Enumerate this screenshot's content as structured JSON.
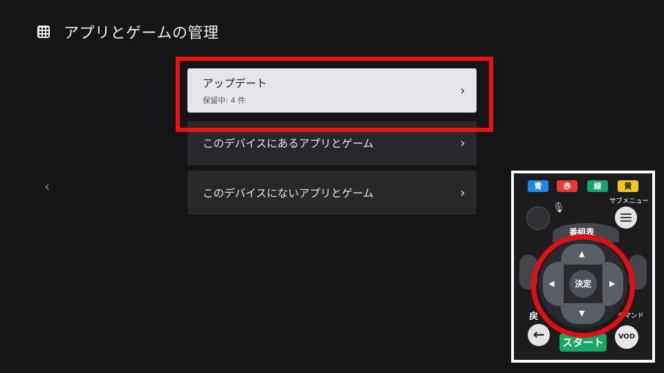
{
  "header": {
    "title": "アプリとゲームの管理",
    "icon": "apps-grid-icon"
  },
  "nav": {
    "back_icon": "chevron-left-icon"
  },
  "menu": {
    "items": [
      {
        "label": "アップデート",
        "sublabel": "保留中: 4 件",
        "selected": true
      },
      {
        "label": "このデバイスにあるアプリとゲーム",
        "selected": false
      },
      {
        "label": "このデバイスにないアプリとゲーム",
        "selected": false
      }
    ]
  },
  "colors": {
    "background": "#151517",
    "item_bg": "#28282b",
    "selected_bg": "#e6e6ea",
    "highlight": "#ee1111"
  },
  "remote": {
    "color_buttons": [
      {
        "label": "青",
        "color": "#1e88e5"
      },
      {
        "label": "赤",
        "color": "#e53935"
      },
      {
        "label": "緑",
        "color": "#17a673"
      },
      {
        "label": "黄",
        "color": "#f5c518"
      }
    ],
    "submenu_label": "サブメニュー",
    "bangumi_label": "番組表",
    "ok_label": "決定",
    "return_label": "戻",
    "back_glyph": "←",
    "start_label": "スタート",
    "demand_label": "デマンド",
    "vod_label": "VOD",
    "up_glyph": "▲",
    "down_glyph": "▼",
    "left_glyph": "◀",
    "right_glyph": "▶"
  }
}
